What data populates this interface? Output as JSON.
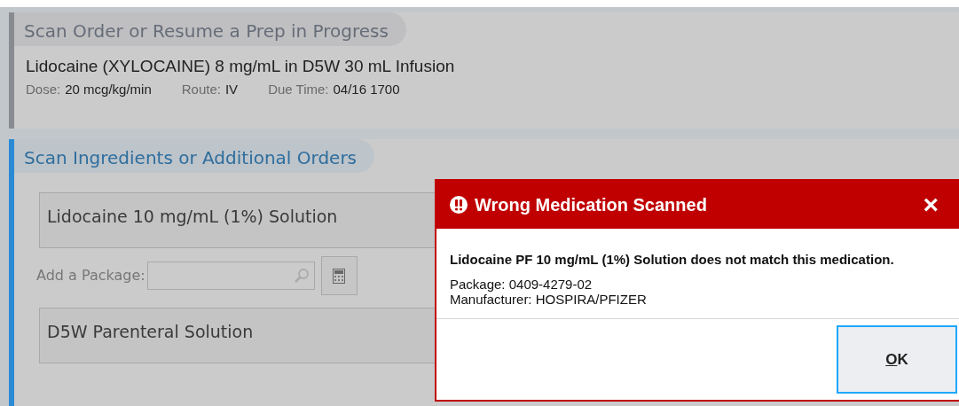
{
  "order_panel": {
    "title": "Scan Order or Resume a Prep in Progress",
    "medication": "Lidocaine (XYLOCAINE) 8 mg/mL in D5W 30 mL Infusion",
    "details": [
      {
        "label": "Dose:",
        "value": "20 mcg/kg/min"
      },
      {
        "label": "Route:",
        "value": "IV"
      },
      {
        "label": "Due Time:",
        "value": "04/16 1700"
      }
    ]
  },
  "ingredients_panel": {
    "title": "Scan Ingredients or Additional Orders",
    "ingredients": [
      "Lidocaine 10 mg/mL (1%) Solution",
      "D5W Parenteral Solution"
    ],
    "package_label": "Add a Package:"
  },
  "dialog": {
    "title": "Wrong Medication Scanned",
    "message": "Lidocaine PF 10 mg/mL (1%) Solution does not match this medication.",
    "package": "Package: 0409-4279-02",
    "manufacturer": "Manufacturer: HOSPIRA/PFIZER",
    "button": "OK",
    "close": "×"
  }
}
